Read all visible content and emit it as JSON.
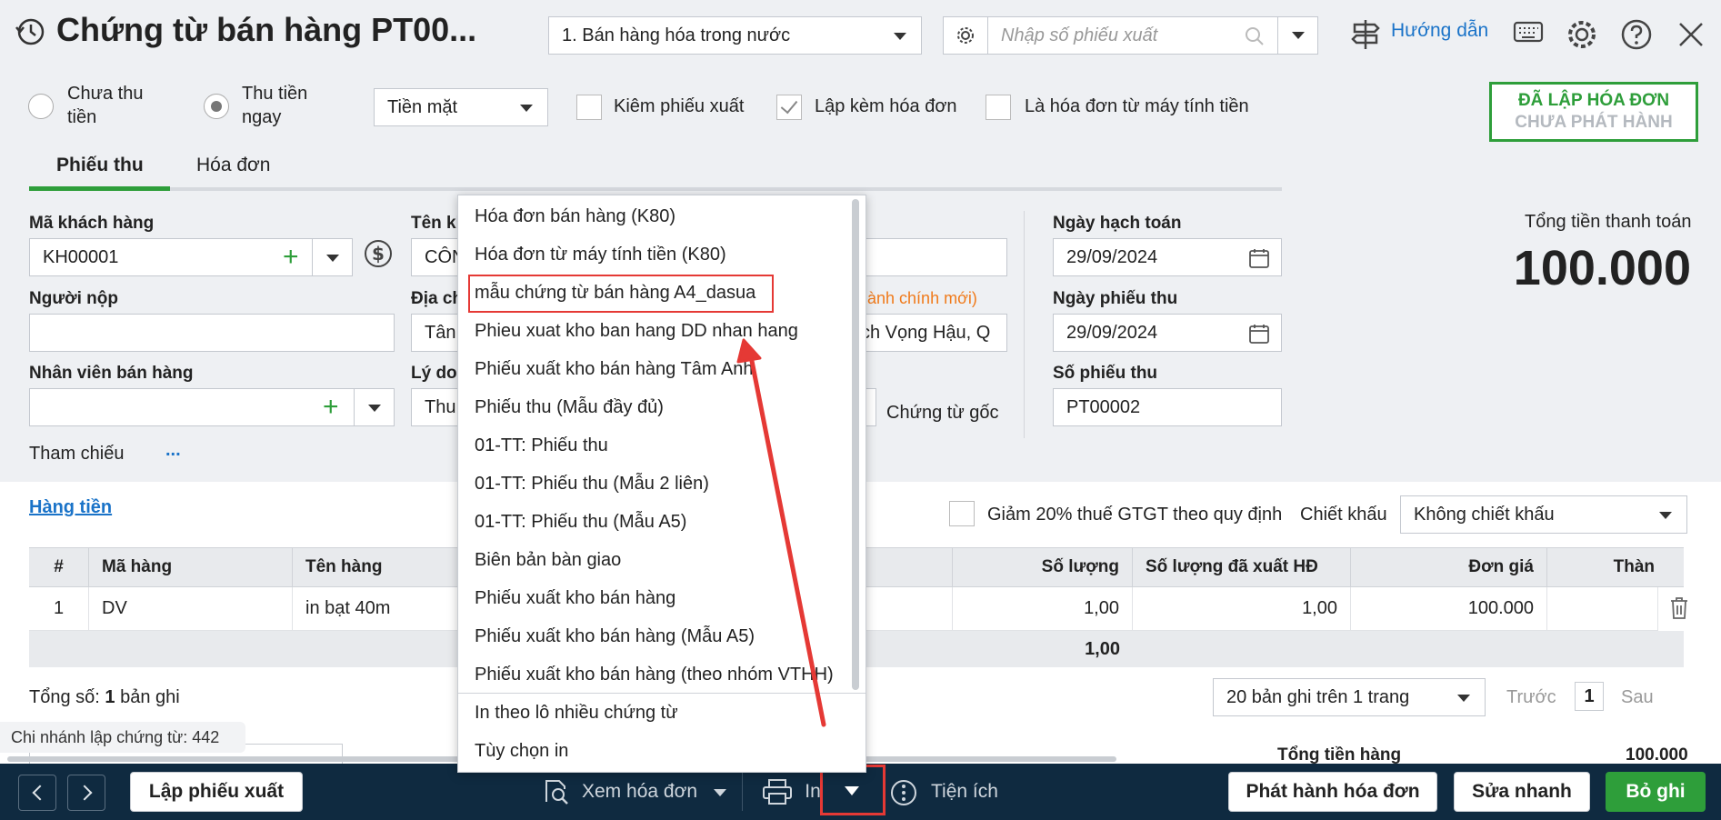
{
  "header": {
    "title": "Chứng từ bán hàng PT00...",
    "sale_type": "1. Bán hàng hóa trong nước",
    "search_placeholder": "Nhập số phiếu xuất",
    "help_label": "Hướng dẫn"
  },
  "options": {
    "radio_unpaid_line1": "Chưa thu",
    "radio_unpaid_line2": "tiền",
    "radio_paid_line1": "Thu tiền",
    "radio_paid_line2": "ngay",
    "payment_method": "Tiền mặt",
    "chk_export": "Kiêm phiếu xuất",
    "chk_invoice": "Lập kèm hóa đơn",
    "chk_cash_register": "Là hóa đơn từ máy tính tiền",
    "badge_line1": "ĐÃ LẬP HÓA ĐƠN",
    "badge_line2": "CHƯA PHÁT HÀNH"
  },
  "tabs": [
    {
      "label": "Phiếu thu"
    },
    {
      "label": "Hóa đơn"
    }
  ],
  "form": {
    "customer_code_label": "Mã khách hàng",
    "customer_code": "KH00001",
    "customer_name_label": "Tên kh",
    "customer_name": "CÔN",
    "payer_label": "Người nộp",
    "address_label": "Địa ch",
    "address_value": "Tân",
    "address_right": "ch Vọng Hậu, Q",
    "admin_note": "hành chính mới)",
    "salesperson_label": "Nhân viên bán hàng",
    "reason_label": "Lý do",
    "reason_value": "Thu",
    "original_doc": "Chứng từ gốc",
    "reference_label": "Tham chiếu",
    "reference_more": "...",
    "posting_date_label": "Ngày hạch toán",
    "posting_date": "29/09/2024",
    "receipt_date_label": "Ngày phiếu thu",
    "receipt_date": "29/09/2024",
    "receipt_no_label": "Số phiếu thu",
    "receipt_no": "PT00002",
    "total_label": "Tổng tiền thanh toán",
    "total_value": "100.000"
  },
  "grid": {
    "section_title": "Hàng tiền",
    "vat_reduction": "Giảm 20% thuế GTGT theo quy định",
    "discount_label": "Chiết khấu",
    "discount_value": "Không chiết khấu",
    "columns": [
      "#",
      "Mã hàng",
      "Tên hàng",
      "Số lượng",
      "Số lượng đã xuất HĐ",
      "Đơn giá",
      "Thàn"
    ],
    "row": {
      "no": "1",
      "code": "DV",
      "name": "in bạt 40m",
      "qty": "1,00",
      "qty_invoiced": "1,00",
      "price": "100.000"
    },
    "sum_qty": "1,00",
    "total_records_prefix": "Tổng số:",
    "total_records_count": "1",
    "total_records_suffix": "bản ghi",
    "page_size": "20 bản ghi trên 1 trang",
    "prev": "Trước",
    "page": "1",
    "next": "Sau",
    "goods_total_label": "Tổng tiền hàng",
    "goods_total_value": "100.000"
  },
  "branch_tip": "Chi nhánh lập chứng từ: 442",
  "print_menu": [
    "Hóa đơn bán hàng (K80)",
    "Hóa đơn từ máy tính tiền (K80)",
    "mẫu chứng từ bán hàng A4_dasua",
    "Phieu xuat kho ban hang DD nhan hang",
    "Phiếu xuất kho bán hàng Tâm Anh",
    "Phiếu thu (Mẫu đầy đủ)",
    "01-TT: Phiếu thu",
    "01-TT: Phiếu thu (Mẫu 2 liên)",
    "01-TT: Phiếu thu (Mẫu A5)",
    "Biên bản bàn giao",
    "Phiếu xuất kho bán hàng",
    "Phiếu xuất kho bán hàng (Mẫu A5)",
    "Phiếu xuất kho bán hàng (theo nhóm VTHH)"
  ],
  "print_menu_extra": [
    "In theo lô nhiều chứng từ",
    "Tùy chọn in"
  ],
  "bottom": {
    "create_export": "Lập phiếu xuất",
    "view_invoice": "Xem hóa đơn",
    "print": "In",
    "utilities": "Tiện ích",
    "issue_invoice": "Phát hành hóa đơn",
    "quick_edit": "Sửa nhanh",
    "cancel_post": "Bỏ ghi"
  },
  "colors": {
    "accent_blue": "#1a73c8",
    "green": "#2e9e3a",
    "highlight_red": "#e53935",
    "bottom_bar": "#0f2a40"
  }
}
